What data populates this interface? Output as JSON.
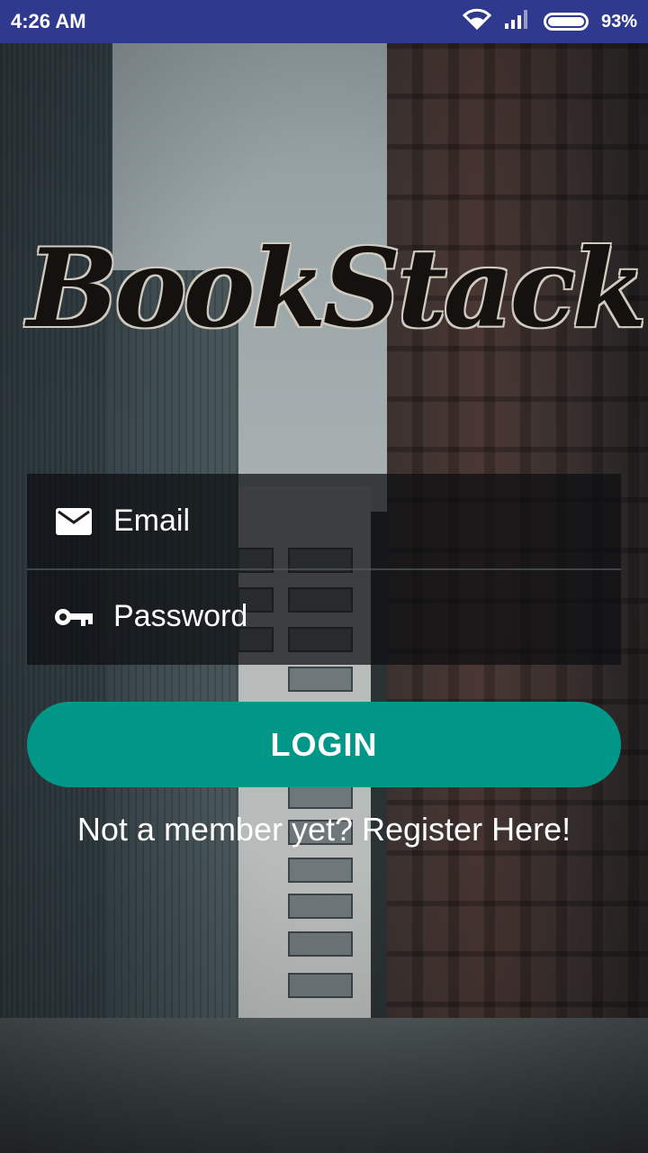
{
  "status_bar": {
    "time": "4:26 AM",
    "battery": "93%"
  },
  "logo": {
    "text": "BookStack"
  },
  "form": {
    "email_placeholder": "Email",
    "password_placeholder": "Password"
  },
  "login_button": {
    "label": "LOGIN"
  },
  "register_link": {
    "text": "Not a member yet? Register Here!"
  },
  "colors": {
    "status_bar": "#2f3a8f",
    "accent": "#009688"
  },
  "icons": [
    "wifi-icon",
    "signal-icon",
    "battery-icon",
    "email-icon",
    "key-icon"
  ]
}
